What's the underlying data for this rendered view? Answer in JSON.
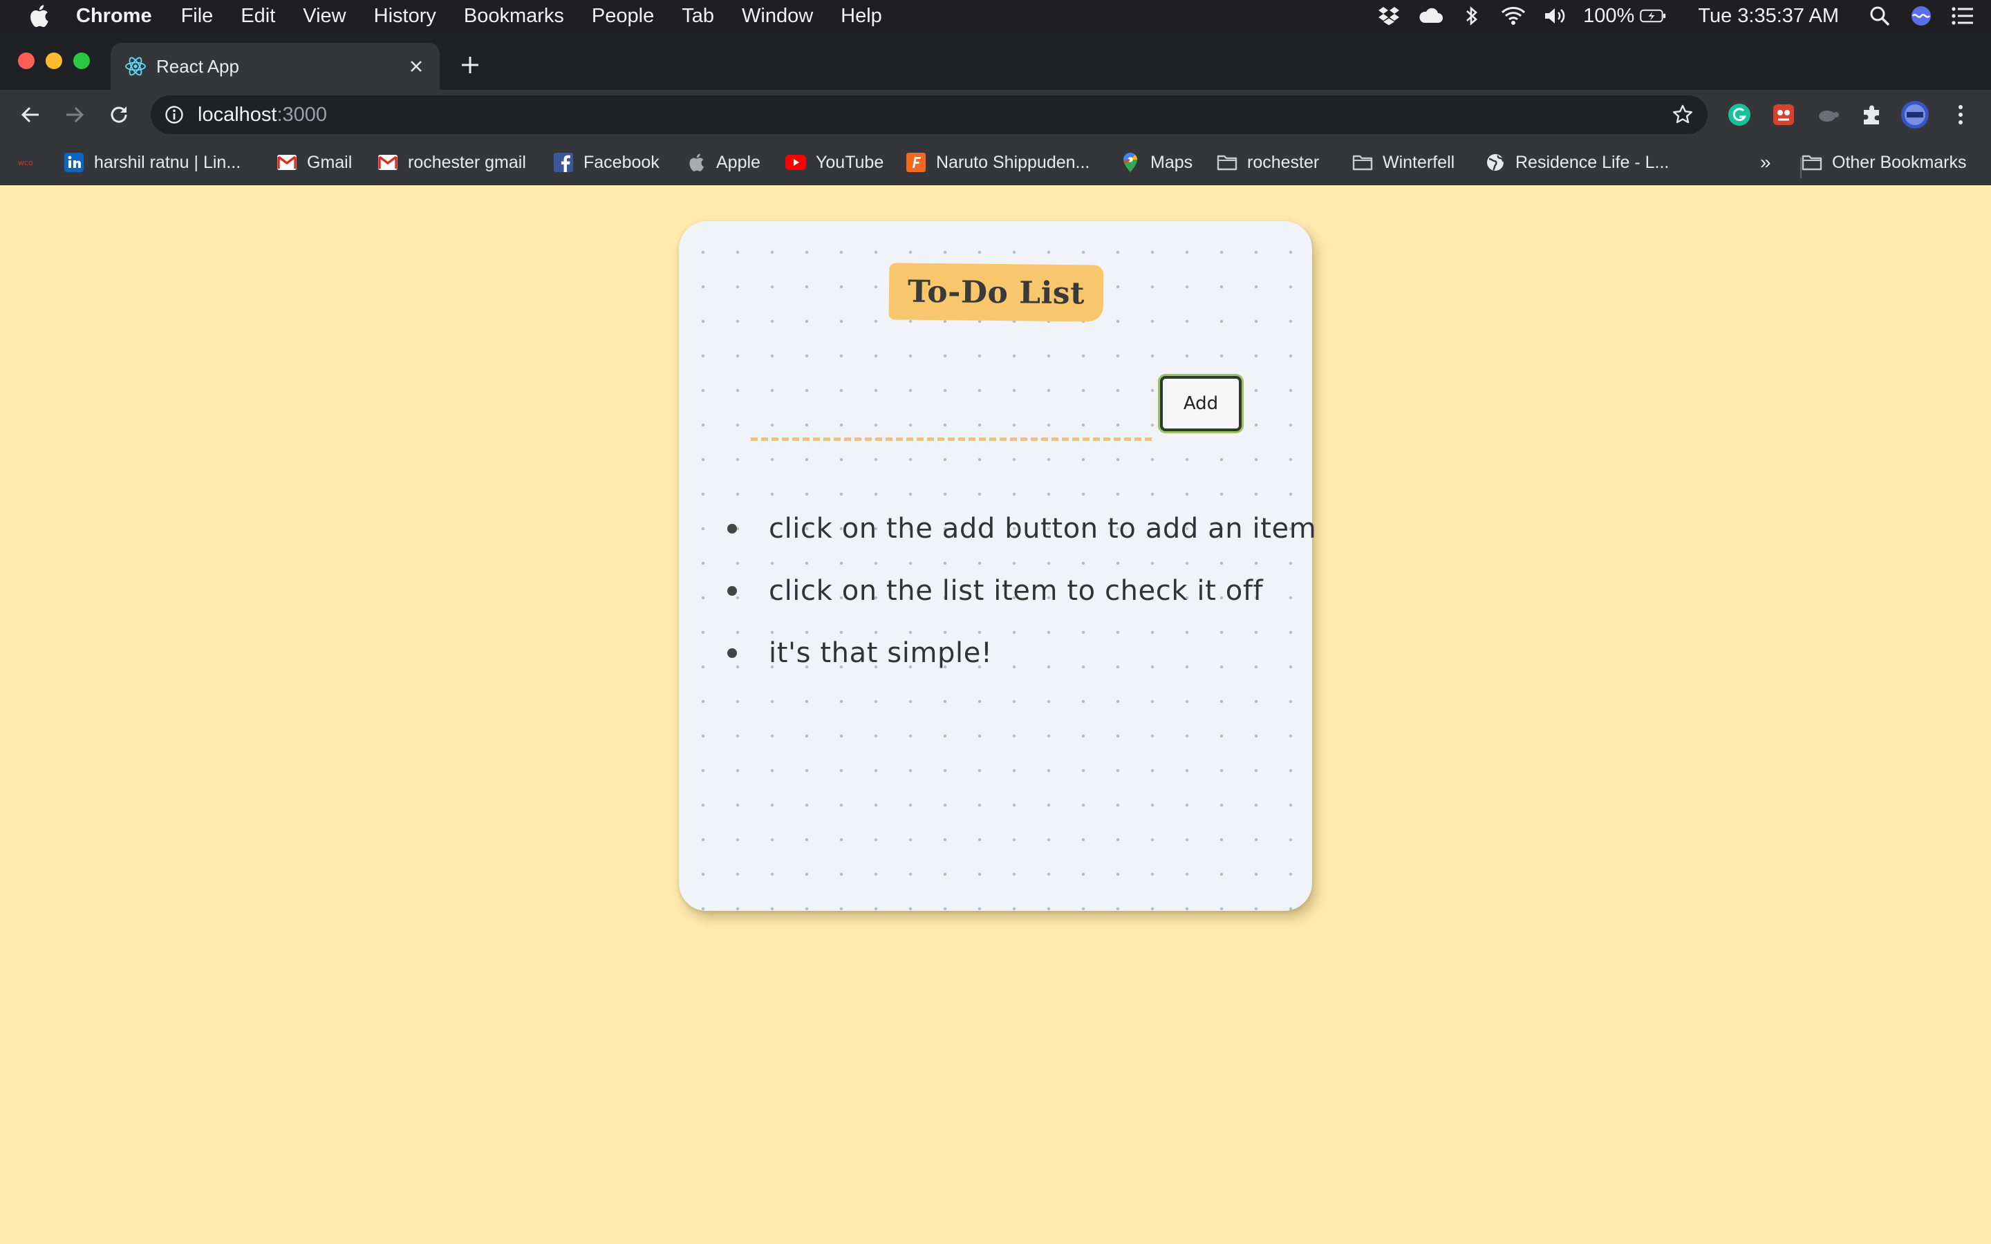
{
  "menubar": {
    "app_name": "Chrome",
    "items": [
      "File",
      "Edit",
      "View",
      "History",
      "Bookmarks",
      "People",
      "Tab",
      "Window",
      "Help"
    ],
    "battery": "100%",
    "clock": "Tue 3:35:37 AM"
  },
  "browser": {
    "tab_title": "React App",
    "url_host": "localhost",
    "url_port": ":3000"
  },
  "bookmarks": [
    {
      "label": "harshil ratnu | Lin...",
      "icon": "linkedin-icon"
    },
    {
      "label": "Gmail",
      "icon": "gmail-icon"
    },
    {
      "label": "rochester gmail",
      "icon": "gmail-icon"
    },
    {
      "label": "Facebook",
      "icon": "facebook-icon"
    },
    {
      "label": "Apple",
      "icon": "apple-icon"
    },
    {
      "label": "YouTube",
      "icon": "youtube-icon"
    },
    {
      "label": "Naruto Shippuden...",
      "icon": "naruto-icon"
    },
    {
      "label": "Maps",
      "icon": "maps-icon"
    },
    {
      "label": "rochester",
      "icon": "folder-icon"
    },
    {
      "label": "Winterfell",
      "icon": "folder-icon"
    },
    {
      "label": "Residence Life - L...",
      "icon": "globe-icon"
    }
  ],
  "bookmarks_overflow": "»",
  "other_bookmarks": "Other Bookmarks",
  "app": {
    "title": "To-Do List",
    "input_value": "",
    "add_label": "Add",
    "items": [
      "click on the add button to add an item",
      "click on the list item to check it off",
      "it's that simple!"
    ]
  },
  "colors": {
    "page_background": "#ffebb0",
    "card_background": "#f1f3f8",
    "title_highlight": "#f7c66d",
    "input_underline": "#f4c06a",
    "button_border": "#2f3a2a",
    "button_glow": "#9cc36a"
  }
}
